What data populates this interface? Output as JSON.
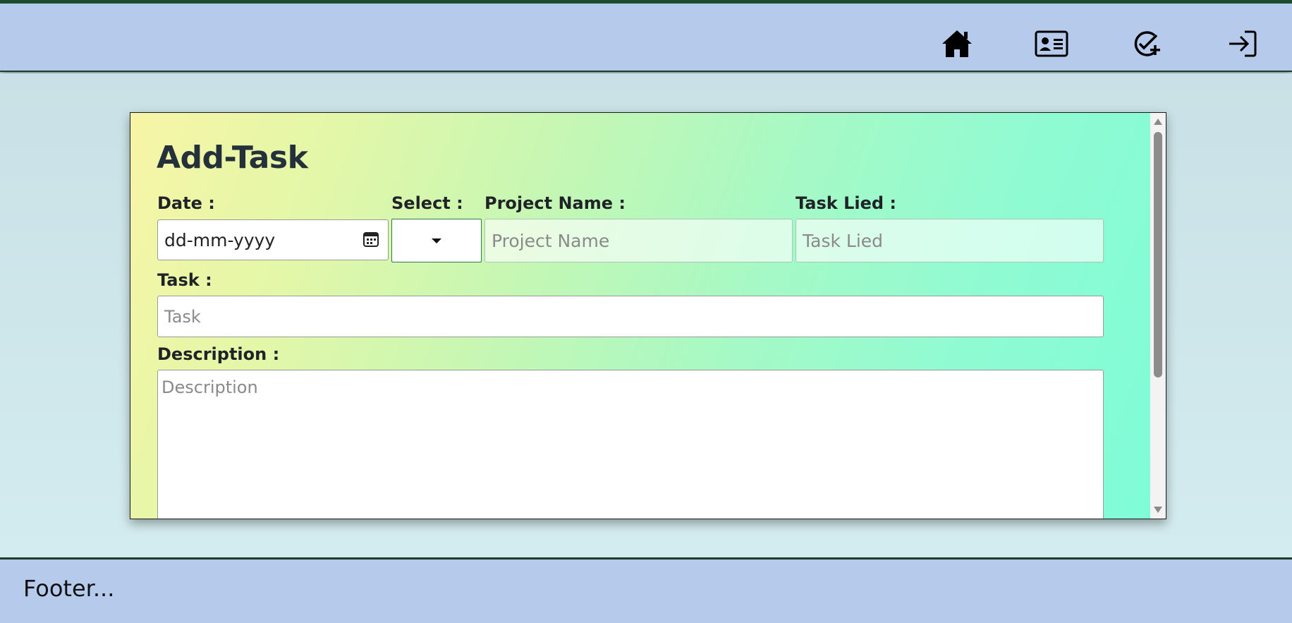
{
  "navbar": {
    "icons": [
      {
        "name": "home-icon"
      },
      {
        "name": "id-card-icon"
      },
      {
        "name": "add-task-icon"
      },
      {
        "name": "sign-in-icon"
      }
    ]
  },
  "form": {
    "title": "Add-Task",
    "date_label": "Date :",
    "date_value": "dd-mm-yyyy",
    "select_label": "Select :",
    "project_label": "Project Name :",
    "project_placeholder": "Project Name",
    "task_lied_label": "Task Lied :",
    "task_lied_placeholder": "Task Lied",
    "task_label": "Task :",
    "task_placeholder": "Task",
    "description_label": "Description :",
    "description_placeholder": "Description"
  },
  "footer": {
    "text": "Footer..."
  },
  "colors": {
    "navbar_bg": "#b6cbec",
    "accent_dark": "#1e3d2b",
    "card_gradient_start": "#f7f5a6",
    "card_gradient_end": "#7efcd7"
  }
}
